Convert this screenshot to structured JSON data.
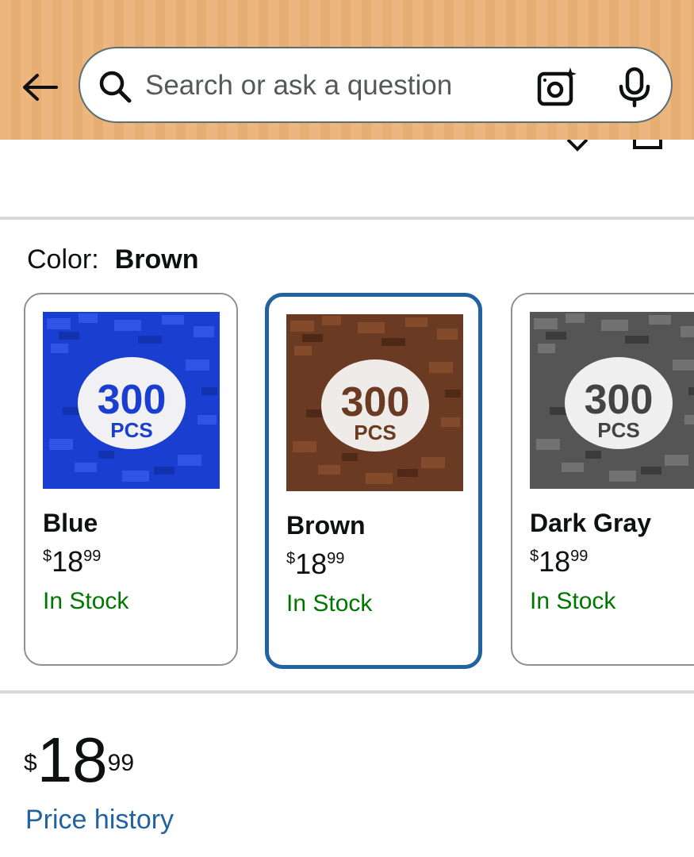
{
  "search": {
    "placeholder": "Search or ask a question"
  },
  "color_selector": {
    "label": "Color:",
    "selected_value": "Brown",
    "options": [
      {
        "name": "Blue",
        "price_symbol": "$",
        "price_whole": "18",
        "price_fraction": "99",
        "stock": "In Stock",
        "image_text_count": "300",
        "image_text_unit": "PCS",
        "image_color": "#1a3fd0"
      },
      {
        "name": "Brown",
        "price_symbol": "$",
        "price_whole": "18",
        "price_fraction": "99",
        "stock": "In Stock",
        "image_text_count": "300",
        "image_text_unit": "PCS",
        "image_color": "#6b3a22"
      },
      {
        "name": "Dark Gray",
        "price_symbol": "$",
        "price_whole": "18",
        "price_fraction": "99",
        "stock": "In Stock",
        "image_text_count": "300",
        "image_text_unit": "PCS",
        "image_color": "#555555"
      }
    ]
  },
  "price": {
    "symbol": "$",
    "whole": "18",
    "fraction": "99",
    "history_link": "Price history"
  },
  "colors": {
    "header_bg": "#ecb67e",
    "selected_border": "#2162a1",
    "in_stock": "#007600",
    "link": "#2162a1"
  },
  "icons": [
    "back-arrow-icon",
    "search-icon",
    "camera-icon",
    "microphone-icon"
  ]
}
